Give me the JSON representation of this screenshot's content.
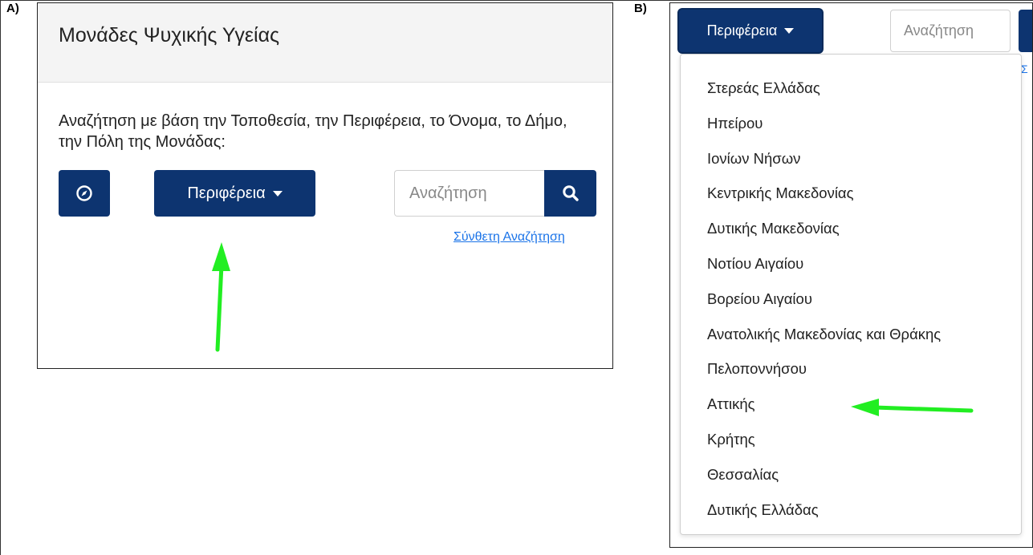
{
  "labels": {
    "panel_a": "A)",
    "panel_b": "B)"
  },
  "panel_a": {
    "title": "Μονάδες Ψυχικής Υγείας",
    "description": "Αναζήτηση με βάση την Τοποθεσία, την Περιφέρεια, το Όνομα, το Δήμο, την Πόλη της Μονάδας:",
    "locate_icon": "compass-icon",
    "region_button": "Περιφέρεια",
    "search_placeholder": "Αναζήτηση",
    "search_icon": "search-icon",
    "advanced_link": "Σύνθετη Αναζήτηση"
  },
  "panel_b": {
    "region_button": "Περιφέρεια",
    "search_placeholder": "Αναζήτηση",
    "edge_glyph": "Σ",
    "dropdown_items": [
      "Στερεάς Ελλάδας",
      "Ηπείρου",
      "Ιονίων Νήσων",
      "Κεντρικής Μακεδονίας",
      "Δυτικής Μακεδονίας",
      "Νοτίου Αιγαίου",
      "Βορείου Αιγαίου",
      "Ανατολικής Μακεδονίας και Θράκης",
      "Πελοποννήσου",
      "Αττικής",
      "Κρήτης",
      "Θεσσαλίας",
      "Δυτικής Ελλάδας"
    ],
    "highlighted_item": "Αττικής"
  },
  "colors": {
    "primary_navy": "#0d3470",
    "header_bg": "#f4f4f4",
    "link_blue": "#1a73e8",
    "annotation_arrow": "#22ee22"
  }
}
